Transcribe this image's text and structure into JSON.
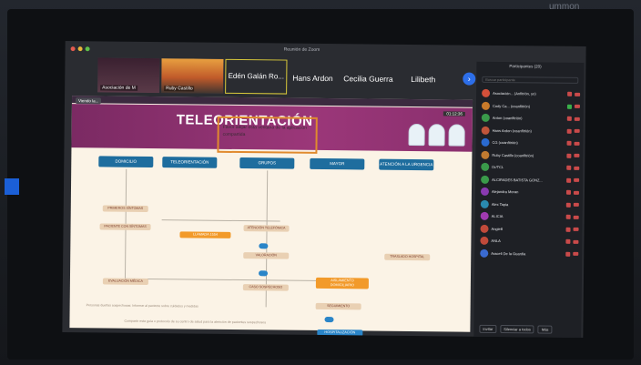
{
  "window": {
    "title": "Reunión de Zoom",
    "traffic_lights": [
      "#e25b4f",
      "#e9b43a",
      "#5fc04b"
    ]
  },
  "glare_text": "ummon",
  "thumbnails": [
    {
      "caption": "Asociación de M"
    },
    {
      "caption": "Ruby Castillo"
    },
    {
      "caption": "",
      "name": "Edén Galán Ro...",
      "selected": true
    }
  ],
  "participants_strip": [
    "Hans Ardon",
    "Cecilia Guerra",
    "Lilibeth"
  ],
  "share": {
    "sharing_label": "Viendo la...",
    "time": "01:12:36",
    "title": "TELEORIENTACIÓN",
    "highlight_text": "Favor alejar esta ventana de la aplicación compartida",
    "columns": [
      "DOMICILIO",
      "TELEORIENTACIÓN",
      "GRUPOS",
      "MAYOR",
      "ATENCIÓN A LA URGENCIA"
    ],
    "nodes": {
      "n1": "PRIMEROS SÍNTOMAS",
      "n2": "PACIENTE CON SÍNTOMAS",
      "n3": "LLAMADA 1554",
      "n4": "ATENCIÓN TELEFÓNICA",
      "n5": "VALORACIÓN",
      "n6": "EVALUACIÓN MÉDICA",
      "n7": "CASO SOSPECHOSO",
      "n8": "TRASLADO HOSPITAL",
      "n9": "AISLAMIENTO DOMICILIARIO",
      "n10": "SEGUIMIENTO",
      "n11": "HOSPITALIZACIÓN"
    },
    "footnote": "Personas dueñas sospechosas: Informar al paciente sobre cuidados y medidas",
    "footer": "Compartir esta guía o protocolo de su centro de salud para la atención de pacientes sospechosos"
  },
  "panel": {
    "title": "Participantes (20)",
    "search_placeholder": "Buscar participante",
    "participants": [
      {
        "name": "Asociación... (Anfitrión, yo)",
        "color": "#d4503a"
      },
      {
        "name": "Cody Ca... (coanfitrión)",
        "color": "#c87a2a"
      },
      {
        "name": "Anton (coanfitrión)",
        "color": "#3a9a4a"
      },
      {
        "name": "Hans Ardon (coanfitrión)",
        "color": "#c0553a"
      },
      {
        "name": "CG (coanfitrión)",
        "color": "#2a6ad0"
      },
      {
        "name": "Ruby Castillo (coanfitrión)",
        "color": "#c07a30"
      },
      {
        "name": "Dr/TCL",
        "color": "#3a9a4a"
      },
      {
        "name": "ALCIRADES BATISTA GONZ...",
        "color": "#3a9a4a"
      },
      {
        "name": "Alejandra Moran",
        "color": "#8a3ab0"
      },
      {
        "name": "Alex Tapia",
        "color": "#2a8ab0"
      },
      {
        "name": "ALICIA",
        "color": "#a03ab0"
      },
      {
        "name": "Angie8",
        "color": "#c04a3a"
      },
      {
        "name": "ANLA",
        "color": "#c04a3a"
      },
      {
        "name": "Araceli De la Guardia",
        "color": "#3a6ad0"
      }
    ],
    "buttons": [
      "Invitar",
      "Silenciar a todos",
      "Más"
    ]
  }
}
